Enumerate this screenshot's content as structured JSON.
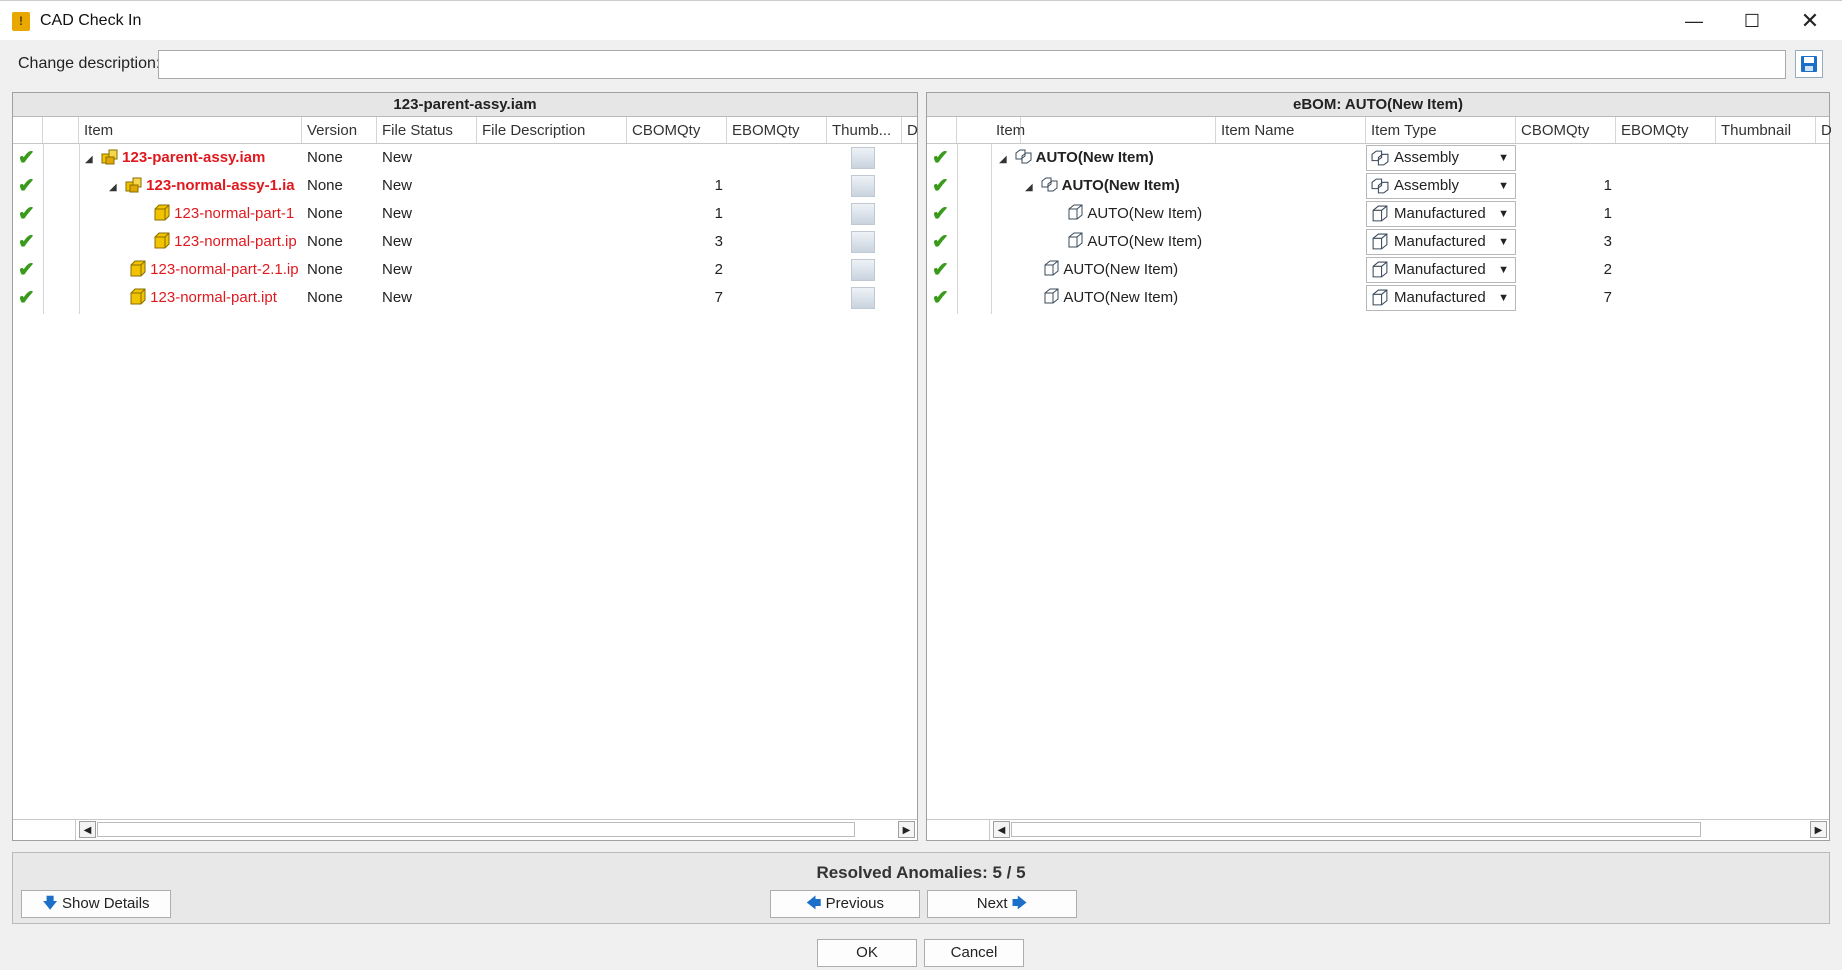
{
  "window": {
    "title": "CAD Check In",
    "minimize_icon": "minimize-icon",
    "maximize_icon": "maximize-icon",
    "close_icon": "close-icon"
  },
  "description": {
    "label": "Change description:",
    "value": "",
    "save_icon": "save-icon"
  },
  "left_pane": {
    "title": "123-parent-assy.iam",
    "columns": [
      "Item",
      "Version",
      "File Status",
      "File Description",
      "CBOMQty",
      "EBOMQty",
      "Thumb...",
      "D"
    ],
    "rows": [
      {
        "item": "123-parent-assy.iam",
        "version": "None",
        "status": "New",
        "description": "",
        "cbom": "",
        "ebom": "",
        "type": "assembly"
      },
      {
        "item": "123-normal-assy-1.ia",
        "version": "None",
        "status": "New",
        "description": "",
        "cbom": "",
        "ebom": "1",
        "type": "assembly"
      },
      {
        "item": "123-normal-part-1",
        "version": "None",
        "status": "New",
        "description": "",
        "cbom": "",
        "ebom": "1",
        "type": "part"
      },
      {
        "item": "123-normal-part.ip",
        "version": "None",
        "status": "New",
        "description": "",
        "cbom": "",
        "ebom": "3",
        "type": "part"
      },
      {
        "item": "123-normal-part-2.1.ip",
        "version": "None",
        "status": "New",
        "description": "",
        "cbom": "",
        "ebom": "2",
        "type": "part"
      },
      {
        "item": "123-normal-part.ipt",
        "version": "None",
        "status": "New",
        "description": "",
        "cbom": "",
        "ebom": "7",
        "type": "part"
      }
    ]
  },
  "right_pane": {
    "title": "eBOM: AUTO(New Item)",
    "columns": [
      "Item",
      "Item Name",
      "Item Type",
      "CBOMQty",
      "EBOMQty",
      "Thumbnail",
      "D"
    ],
    "rows": [
      {
        "item": "AUTO(New Item)",
        "item_type": "Assembly",
        "cbom": "",
        "ebom": ""
      },
      {
        "item": "AUTO(New Item)",
        "item_type": "Assembly",
        "cbom": "",
        "ebom": "1"
      },
      {
        "item": "AUTO(New Item)",
        "item_type": "Manufactured",
        "cbom": "",
        "ebom": "1"
      },
      {
        "item": "AUTO(New Item)",
        "item_type": "Manufactured",
        "cbom": "",
        "ebom": "3"
      },
      {
        "item": "AUTO(New Item)",
        "item_type": "Manufactured",
        "cbom": "",
        "ebom": "2"
      },
      {
        "item": "AUTO(New Item)",
        "item_type": "Manufactured",
        "cbom": "",
        "ebom": "7"
      }
    ]
  },
  "footer": {
    "resolved": "Resolved Anomalies: 5 / 5",
    "show_details": "Show Details",
    "previous": "Previous",
    "next": "Next",
    "ok": "OK",
    "cancel": "Cancel"
  },
  "colors": {
    "check": "#3a9a1c",
    "error_text": "#e0191f",
    "part_icon": "#f2c300",
    "assembly_icon": "#f2c300"
  }
}
